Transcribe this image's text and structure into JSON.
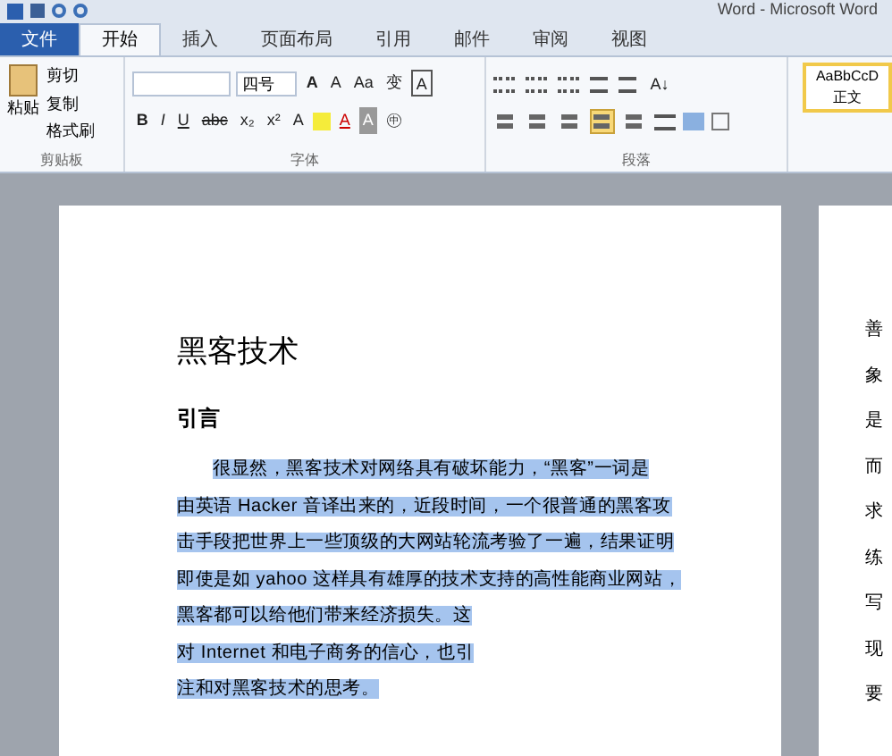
{
  "window": {
    "title": "Word - Microsoft Word"
  },
  "tabs": [
    {
      "label": "文件",
      "kind": "file",
      "selected": false
    },
    {
      "label": "开始",
      "kind": "tab",
      "selected": true
    },
    {
      "label": "插入",
      "kind": "tab",
      "selected": false
    },
    {
      "label": "页面布局",
      "kind": "tab",
      "selected": false
    },
    {
      "label": "引用",
      "kind": "tab",
      "selected": false
    },
    {
      "label": "邮件",
      "kind": "tab",
      "selected": false
    },
    {
      "label": "审阅",
      "kind": "tab",
      "selected": false
    },
    {
      "label": "视图",
      "kind": "tab",
      "selected": false
    }
  ],
  "clipboard": {
    "paste": "粘贴",
    "cut": "剪切",
    "copy": "复制",
    "format_painter": "格式刷",
    "label": "剪贴板"
  },
  "font": {
    "size": "四号",
    "label": "字体",
    "case": "Aa",
    "bold": "B",
    "italic": "I",
    "underline": "U",
    "strike": "abc",
    "sub": "x₂",
    "sup": "x²",
    "grow": "A",
    "shrink": "A",
    "wen": "变",
    "border": "A",
    "effects": "A",
    "font_color": "A",
    "shade": "A",
    "enclose": "㊥"
  },
  "paragraph": {
    "label": "段落",
    "sort": "A↓",
    "align": [
      {
        "selected": false
      },
      {
        "selected": false
      },
      {
        "selected": false
      },
      {
        "selected": true
      },
      {
        "selected": false
      }
    ]
  },
  "styles": {
    "sample": "AaBbCcD",
    "name": "正文"
  },
  "page1": {
    "title": "黑客技术",
    "heading": "引言",
    "lines": [
      "很显然，黑客技术对网络具有破坏能力，“黑客”一词是",
      "由英语 Hacker 音译出来的，近段时间，一个很普通的黑客攻",
      "击手段把世界上一些顶级的大网站轮流考验了一遍，结果证明",
      "即使是如 yahoo 这样具有雄厚的技术支持的高性能商业网站，",
      "黑客都可以给他们带来经济损失。这",
      "对 Internet 和电子商务的信心，也引",
      "注和对黑客技术的思考。"
    ]
  },
  "page2": {
    "chars": [
      "善",
      "象",
      "是",
      "而",
      "求",
      "练",
      "写",
      "现",
      "要"
    ]
  }
}
